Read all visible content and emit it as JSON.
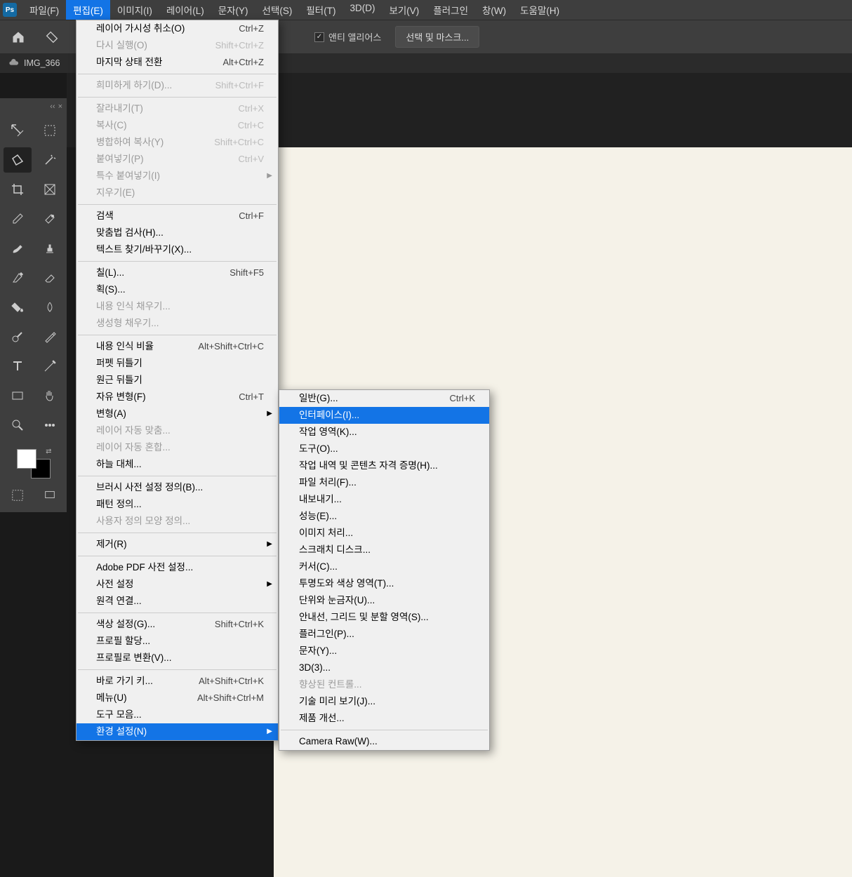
{
  "menubar": {
    "items": [
      "파일(F)",
      "편집(E)",
      "이미지(I)",
      "레이어(L)",
      "문자(Y)",
      "선택(S)",
      "필터(T)",
      "3D(D)",
      "보기(V)",
      "플러그인",
      "창(W)",
      "도움말(H)"
    ],
    "openIndex": 1
  },
  "optionsbar": {
    "antialias": "앤티 앨리어스",
    "selectMask": "선택 및 마스크..."
  },
  "tab": {
    "filename": "IMG_366"
  },
  "editMenu": [
    {
      "label": "레이어 가시성 취소(O)",
      "shortcut": "Ctrl+Z"
    },
    {
      "label": "다시 실행(O)",
      "shortcut": "Shift+Ctrl+Z",
      "disabled": true
    },
    {
      "label": "마지막 상태 전환",
      "shortcut": "Alt+Ctrl+Z"
    },
    {
      "sep": true
    },
    {
      "label": "희미하게 하기(D)...",
      "shortcut": "Shift+Ctrl+F",
      "disabled": true
    },
    {
      "sep": true
    },
    {
      "label": "잘라내기(T)",
      "shortcut": "Ctrl+X",
      "disabled": true
    },
    {
      "label": "복사(C)",
      "shortcut": "Ctrl+C",
      "disabled": true
    },
    {
      "label": "병합하여 복사(Y)",
      "shortcut": "Shift+Ctrl+C",
      "disabled": true
    },
    {
      "label": "붙여넣기(P)",
      "shortcut": "Ctrl+V",
      "disabled": true
    },
    {
      "label": "특수 붙여넣기(I)",
      "sub": true,
      "disabled": true
    },
    {
      "label": "지우기(E)",
      "disabled": true
    },
    {
      "sep": true
    },
    {
      "label": "검색",
      "shortcut": "Ctrl+F"
    },
    {
      "label": "맞춤법 검사(H)..."
    },
    {
      "label": "텍스트 찾기/바꾸기(X)..."
    },
    {
      "sep": true
    },
    {
      "label": "칠(L)...",
      "shortcut": "Shift+F5"
    },
    {
      "label": "획(S)..."
    },
    {
      "label": "내용 인식 채우기...",
      "disabled": true
    },
    {
      "label": "생성형 채우기...",
      "disabled": true
    },
    {
      "sep": true
    },
    {
      "label": "내용 인식 비율",
      "shortcut": "Alt+Shift+Ctrl+C"
    },
    {
      "label": "퍼펫 뒤틀기"
    },
    {
      "label": "원근 뒤틀기"
    },
    {
      "label": "자유 변형(F)",
      "shortcut": "Ctrl+T"
    },
    {
      "label": "변형(A)",
      "sub": true
    },
    {
      "label": "레이어 자동 맞춤...",
      "disabled": true
    },
    {
      "label": "레이어 자동 혼합...",
      "disabled": true
    },
    {
      "label": "하늘 대체..."
    },
    {
      "sep": true
    },
    {
      "label": "브러시 사전 설정 정의(B)..."
    },
    {
      "label": "패턴 정의..."
    },
    {
      "label": "사용자 정의 모양 정의...",
      "disabled": true
    },
    {
      "sep": true
    },
    {
      "label": "제거(R)",
      "sub": true
    },
    {
      "sep": true
    },
    {
      "label": "Adobe PDF 사전 설정..."
    },
    {
      "label": "사전 설정",
      "sub": true
    },
    {
      "label": "원격 연결..."
    },
    {
      "sep": true
    },
    {
      "label": "색상 설정(G)...",
      "shortcut": "Shift+Ctrl+K"
    },
    {
      "label": "프로필 할당..."
    },
    {
      "label": "프로필로 변환(V)..."
    },
    {
      "sep": true
    },
    {
      "label": "바로 가기 키...",
      "shortcut": "Alt+Shift+Ctrl+K"
    },
    {
      "label": "메뉴(U)",
      "shortcut": "Alt+Shift+Ctrl+M"
    },
    {
      "label": "도구 모음..."
    },
    {
      "label": "환경 설정(N)",
      "sub": true,
      "hl": true
    }
  ],
  "prefsSubmenu": [
    {
      "label": "일반(G)...",
      "shortcut": "Ctrl+K"
    },
    {
      "label": "인터페이스(I)...",
      "hl": true
    },
    {
      "label": "작업 영역(K)..."
    },
    {
      "label": "도구(O)..."
    },
    {
      "label": "작업 내역 및 콘텐츠 자격 증명(H)..."
    },
    {
      "label": "파일 처리(F)..."
    },
    {
      "label": "내보내기..."
    },
    {
      "label": "성능(E)..."
    },
    {
      "label": "이미지 처리..."
    },
    {
      "label": "스크래치 디스크..."
    },
    {
      "label": "커서(C)..."
    },
    {
      "label": "투명도와 색상 영역(T)..."
    },
    {
      "label": "단위와 눈금자(U)..."
    },
    {
      "label": "안내선, 그리드 및 분할 영역(S)..."
    },
    {
      "label": "플러그인(P)..."
    },
    {
      "label": "문자(Y)..."
    },
    {
      "label": "3D(3)..."
    },
    {
      "label": "향상된 컨트롤...",
      "disabled": true
    },
    {
      "label": "기술 미리 보기(J)..."
    },
    {
      "label": "제품 개선..."
    },
    {
      "sep": true
    },
    {
      "label": "Camera Raw(W)..."
    }
  ],
  "tools": [
    "move",
    "marquee",
    "lasso",
    "wand",
    "crop",
    "frame",
    "eyedrop",
    "heal",
    "brush",
    "stamp",
    "history",
    "eraser",
    "bucket",
    "blur",
    "dodge",
    "pen",
    "type",
    "path",
    "rect",
    "hand",
    "zoom",
    "ellipsis"
  ]
}
